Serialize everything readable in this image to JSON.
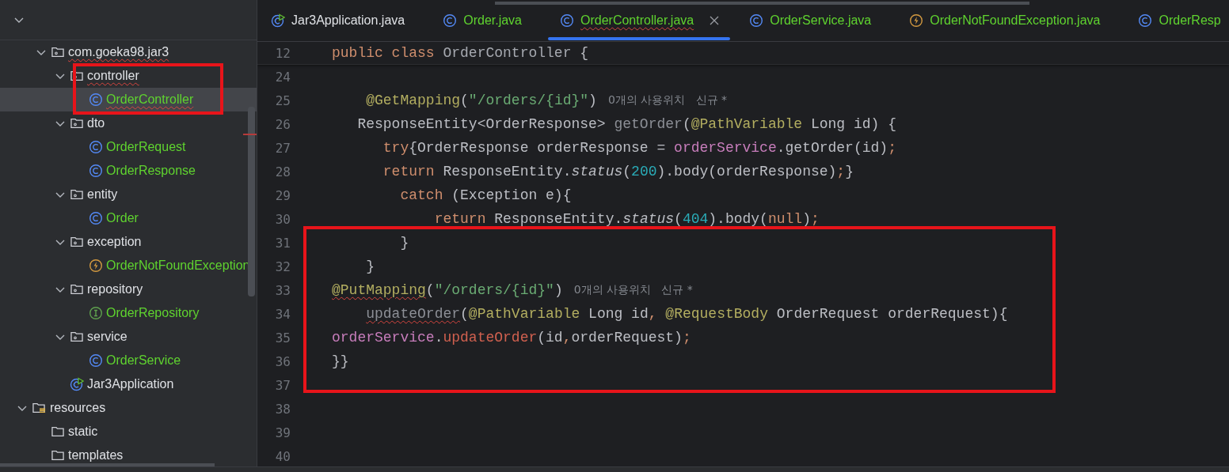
{
  "tree": [
    {
      "children": [
        {
          "label": "com.goeka98.jar3",
          "kind": "package",
          "expanded": true,
          "selected": false,
          "squiggly": true,
          "color": "#dfe1e5",
          "children": [
            {
              "label": "controller",
              "kind": "package",
              "expanded": true,
              "selected": false,
              "squiggly": true,
              "color": "#dfe1e5",
              "children": [
                {
                  "label": "OrderController",
                  "kind": "class",
                  "selected": true,
                  "squiggly": true,
                  "color": "#5fd32f"
                }
              ]
            },
            {
              "label": "dto",
              "kind": "package",
              "expanded": true,
              "selected": false,
              "color": "#dfe1e5",
              "children": [
                {
                  "label": "OrderRequest",
                  "kind": "class",
                  "selected": false,
                  "color": "#5fd32f"
                },
                {
                  "label": "OrderResponse",
                  "kind": "class",
                  "selected": false,
                  "color": "#5fd32f"
                }
              ]
            },
            {
              "label": "entity",
              "kind": "package",
              "expanded": true,
              "selected": false,
              "color": "#dfe1e5",
              "children": [
                {
                  "label": "Order",
                  "kind": "class",
                  "selected": false,
                  "color": "#5fd32f"
                }
              ]
            },
            {
              "label": "exception",
              "kind": "package",
              "expanded": true,
              "selected": false,
              "color": "#dfe1e5",
              "children": [
                {
                  "label": "OrderNotFoundException",
                  "kind": "exception",
                  "selected": false,
                  "color": "#5fd32f"
                }
              ]
            },
            {
              "label": "repository",
              "kind": "package",
              "expanded": true,
              "selected": false,
              "color": "#dfe1e5",
              "children": [
                {
                  "label": "OrderRepository",
                  "kind": "interface",
                  "selected": false,
                  "color": "#5fd32f"
                }
              ]
            },
            {
              "label": "service",
              "kind": "package",
              "expanded": true,
              "selected": false,
              "color": "#dfe1e5",
              "children": [
                {
                  "label": "OrderService",
                  "kind": "class",
                  "selected": false,
                  "color": "#5fd32f"
                }
              ]
            },
            {
              "label": "Jar3Application",
              "kind": "application",
              "selected": false,
              "color": "#dfe1e5"
            }
          ]
        }
      ]
    },
    {
      "label": "resources",
      "kind": "resources",
      "expanded": true,
      "selected": false,
      "color": "#dfe1e5",
      "children": [
        {
          "label": "static",
          "kind": "folder",
          "selected": false,
          "color": "#dfe1e5"
        },
        {
          "label": "templates",
          "kind": "folder",
          "selected": false,
          "color": "#dfe1e5"
        }
      ]
    }
  ],
  "tabs": [
    {
      "label": "Jar3Application.java",
      "kind": "application",
      "selected": false,
      "color": "#dfe1e5"
    },
    {
      "label": "Order.java",
      "kind": "class",
      "selected": false,
      "color": "#5fd32f"
    },
    {
      "label": "OrderController.java",
      "kind": "class",
      "selected": true,
      "squiggly": true,
      "closable": true,
      "color": "#5fd32f"
    },
    {
      "label": "OrderService.java",
      "kind": "class",
      "selected": false,
      "color": "#5fd32f"
    },
    {
      "label": "OrderNotFoundException.java",
      "kind": "exception",
      "selected": false,
      "color": "#5fd32f"
    },
    {
      "label": "OrderResp",
      "kind": "class",
      "selected": false,
      "color": "#5fd32f"
    }
  ],
  "editor": {
    "sticky_line": {
      "number": "12",
      "tokens": [
        {
          "kind": "keyword",
          "text": "public class "
        },
        {
          "kind": "class-name",
          "text": "OrderController "
        },
        {
          "kind": "plain",
          "text": "{"
        }
      ]
    },
    "lines": [
      {
        "number": "24"
      },
      {
        "number": "25",
        "tokens": [
          {
            "kind": "annotation",
            "text": "    @GetMapping"
          },
          {
            "kind": "plain",
            "text": "("
          },
          {
            "kind": "string",
            "text": "\"/orders/{id}\""
          },
          {
            "kind": "plain",
            "text": ")"
          }
        ],
        "hint": "0개의 사용위치   신규 *"
      },
      {
        "number": "26",
        "tokens": [
          {
            "kind": "plain",
            "text": "   ResponseEntity<OrderResponse> "
          },
          {
            "kind": "unused",
            "text": "getOrder"
          },
          {
            "kind": "plain",
            "text": "("
          },
          {
            "kind": "annotation",
            "text": "@PathVariable"
          },
          {
            "kind": "plain",
            "text": " Long id) {"
          }
        ]
      },
      {
        "number": "27",
        "tokens": [
          {
            "kind": "keyword",
            "text": "      try"
          },
          {
            "kind": "plain",
            "text": "{OrderResponse orderResponse = "
          },
          {
            "kind": "field",
            "text": "orderService"
          },
          {
            "kind": "plain",
            "text": ".getOrder(id)"
          },
          {
            "kind": "keyword",
            "text": ";"
          }
        ]
      },
      {
        "number": "28",
        "tokens": [
          {
            "kind": "keyword",
            "text": "      return "
          },
          {
            "kind": "plain",
            "text": "ResponseEntity."
          },
          {
            "kind": "static-call",
            "text": "status"
          },
          {
            "kind": "plain",
            "text": "("
          },
          {
            "kind": "number",
            "text": "200"
          },
          {
            "kind": "plain",
            "text": ").body(orderResponse)"
          },
          {
            "kind": "keyword",
            "text": ";"
          },
          {
            "kind": "plain",
            "text": "}"
          }
        ]
      },
      {
        "number": "29",
        "tokens": [
          {
            "kind": "keyword",
            "text": "        catch "
          },
          {
            "kind": "plain",
            "text": "(Exception e){"
          }
        ]
      },
      {
        "number": "30",
        "tokens": [
          {
            "kind": "keyword",
            "text": "            return "
          },
          {
            "kind": "plain",
            "text": "ResponseEntity."
          },
          {
            "kind": "static-call",
            "text": "status"
          },
          {
            "kind": "plain",
            "text": "("
          },
          {
            "kind": "number",
            "text": "404"
          },
          {
            "kind": "plain",
            "text": ").body("
          },
          {
            "kind": "keyword",
            "text": "null"
          },
          {
            "kind": "plain",
            "text": ")"
          },
          {
            "kind": "keyword",
            "text": ";"
          }
        ]
      },
      {
        "number": "31",
        "tokens": [
          {
            "kind": "plain",
            "text": "        }"
          }
        ]
      },
      {
        "number": "32",
        "tokens": [
          {
            "kind": "plain",
            "text": "    }"
          }
        ]
      },
      {
        "number": "33",
        "tokens": [
          {
            "kind": "annotation",
            "text": "@PutMapping",
            "squiggly": true
          },
          {
            "kind": "plain",
            "text": "("
          },
          {
            "kind": "string",
            "text": "\"/orders/{id}\""
          },
          {
            "kind": "plain",
            "text": ")"
          }
        ],
        "hint": "0개의 사용위치   신규 *"
      },
      {
        "number": "34",
        "tokens": [
          {
            "kind": "unused",
            "text": "    updateOrder",
            "squiggly": true
          },
          {
            "kind": "plain",
            "text": "("
          },
          {
            "kind": "annotation",
            "text": "@PathVariable"
          },
          {
            "kind": "plain",
            "text": " Long id"
          },
          {
            "kind": "keyword",
            "text": ", "
          },
          {
            "kind": "annotation",
            "text": "@RequestBody"
          },
          {
            "kind": "plain",
            "text": " OrderRequest orderRequest){"
          }
        ]
      },
      {
        "number": "35",
        "tokens": [
          {
            "kind": "field",
            "text": "orderService"
          },
          {
            "kind": "plain",
            "text": "."
          },
          {
            "kind": "error-call",
            "text": "updateOrder"
          },
          {
            "kind": "plain",
            "text": "(id"
          },
          {
            "kind": "keyword",
            "text": ","
          },
          {
            "kind": "plain",
            "text": "orderRequest)"
          },
          {
            "kind": "keyword",
            "text": ";"
          }
        ]
      },
      {
        "number": "36",
        "tokens": [
          {
            "kind": "plain",
            "text": "}}"
          }
        ]
      },
      {
        "number": "37"
      },
      {
        "number": "38"
      },
      {
        "number": "39"
      },
      {
        "number": "40"
      }
    ]
  }
}
